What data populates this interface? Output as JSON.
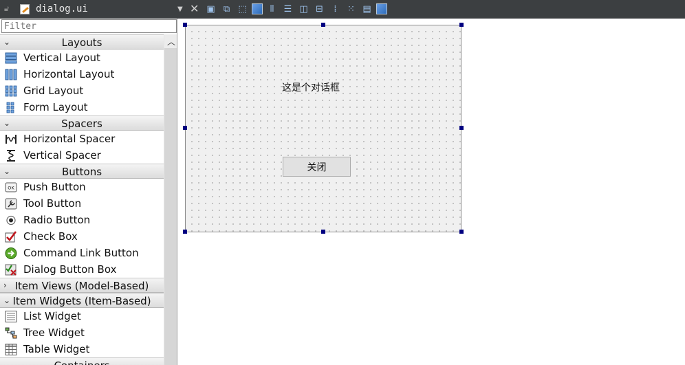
{
  "toolbar": {
    "file_name": "dialog.ui",
    "tools": [
      "edit-widgets-icon",
      "edit-signals-slots-icon",
      "edit-buddies-icon",
      "edit-tab-order-icon",
      "layout-horizontal-icon",
      "layout-vertical-icon",
      "layout-horizontal-splitter-icon",
      "layout-vertical-splitter-icon",
      "layout-form-icon",
      "layout-grid-icon",
      "break-layout-icon",
      "adjust-size-icon"
    ]
  },
  "widgetbox": {
    "filter_placeholder": "Filter",
    "categories": [
      {
        "label": "Layouts",
        "expanded": true,
        "items": [
          "Vertical Layout",
          "Horizontal Layout",
          "Grid Layout",
          "Form Layout"
        ]
      },
      {
        "label": "Spacers",
        "expanded": true,
        "items": [
          "Horizontal Spacer",
          "Vertical Spacer"
        ]
      },
      {
        "label": "Buttons",
        "expanded": true,
        "items": [
          "Push Button",
          "Tool Button",
          "Radio Button",
          "Check Box",
          "Command Link Button",
          "Dialog Button Box"
        ]
      },
      {
        "label": "Item Views (Model-Based)",
        "expanded": false,
        "items": []
      },
      {
        "label": "Item Widgets (Item-Based)",
        "expanded": true,
        "items": [
          "List Widget",
          "Tree Widget",
          "Table Widget"
        ]
      },
      {
        "label": "Containers",
        "expanded": true,
        "items": []
      }
    ]
  },
  "form": {
    "label_text": "这是个对话框",
    "button_text": "关闭"
  }
}
